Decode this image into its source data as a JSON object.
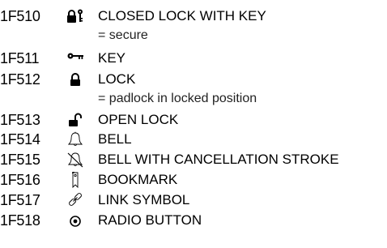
{
  "entries": [
    {
      "code": "1F510",
      "icon": "closed-lock-with-key-icon",
      "name": "CLOSED LOCK WITH KEY",
      "alias": "= secure"
    },
    {
      "code": "1F511",
      "icon": "key-icon",
      "name": "KEY"
    },
    {
      "code": "1F512",
      "icon": "lock-icon",
      "name": "LOCK",
      "alias": "= padlock in locked position"
    },
    {
      "code": "1F513",
      "icon": "open-lock-icon",
      "name": "OPEN LOCK"
    },
    {
      "code": "1F514",
      "icon": "bell-icon",
      "name": "BELL"
    },
    {
      "code": "1F515",
      "icon": "bell-with-cancellation-stroke-icon",
      "name": "BELL WITH CANCELLATION STROKE"
    },
    {
      "code": "1F516",
      "icon": "bookmark-icon",
      "name": "BOOKMARK"
    },
    {
      "code": "1F517",
      "icon": "link-symbol-icon",
      "name": "LINK SYMBOL"
    },
    {
      "code": "1F518",
      "icon": "radio-button-icon",
      "name": "RADIO BUTTON"
    }
  ]
}
